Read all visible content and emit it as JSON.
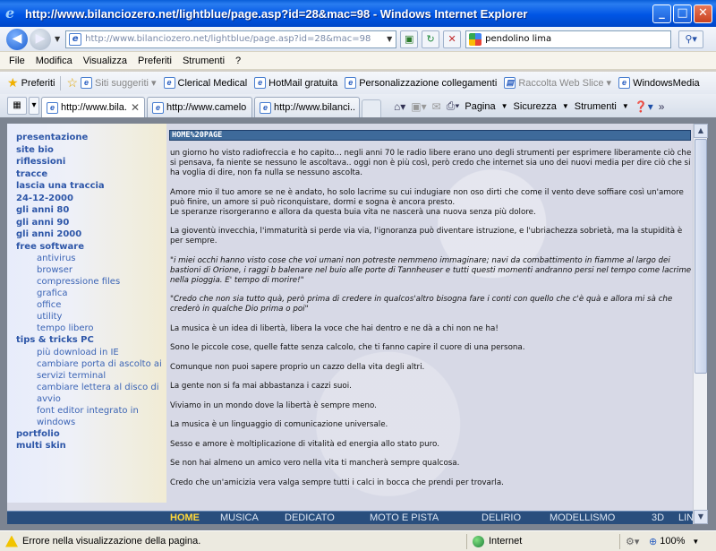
{
  "window": {
    "title": "http://www.bilanciozero.net/lightblue/page.asp?id=28&mac=98 - Windows Internet Explorer",
    "buttons": {
      "minimize": "_",
      "maximize": "□",
      "close": "✕"
    }
  },
  "address": {
    "url": "http://www.bilanciozero.net/lightblue/page.asp?id=28&mac=98",
    "search_query": "pendolino lima"
  },
  "menu": [
    "File",
    "Modifica",
    "Visualizza",
    "Preferiti",
    "Strumenti",
    "?"
  ],
  "favorites": {
    "label": "Preferiti",
    "items": [
      "Siti suggeriti",
      "Clerical Medical",
      "HotMail gratuita",
      "Personalizzazione collegamenti",
      "Raccolta Web Slice",
      "WindowsMedia"
    ]
  },
  "tabs": [
    {
      "label": "http://www.bila..."
    },
    {
      "label": "http://www.camelo..."
    },
    {
      "label": "http://www.bilanci..."
    }
  ],
  "commands": {
    "page": "Pagina",
    "security": "Sicurezza",
    "tools": "Strumenti"
  },
  "sidebar": {
    "items": [
      {
        "label": "presentazione",
        "sub": false
      },
      {
        "label": "site bio",
        "sub": false
      },
      {
        "label": "riflessioni",
        "sub": false
      },
      {
        "label": "tracce",
        "sub": false
      },
      {
        "label": "lascia una traccia",
        "sub": false
      },
      {
        "label": "24-12-2000",
        "sub": false
      },
      {
        "label": "gli anni 80",
        "sub": false
      },
      {
        "label": "gli anni 90",
        "sub": false
      },
      {
        "label": "gli anni 2000",
        "sub": false
      },
      {
        "label": "free software",
        "sub": false
      },
      {
        "label": "antivirus",
        "sub": true
      },
      {
        "label": "browser",
        "sub": true
      },
      {
        "label": "compressione files",
        "sub": true
      },
      {
        "label": "grafica",
        "sub": true
      },
      {
        "label": "office",
        "sub": true
      },
      {
        "label": "utility",
        "sub": true
      },
      {
        "label": "tempo libero",
        "sub": true
      },
      {
        "label": "tips & tricks PC",
        "sub": false
      },
      {
        "label": "più download in IE",
        "sub": true
      },
      {
        "label": "cambiare porta di ascolto ai servizi terminal",
        "sub": true
      },
      {
        "label": "cambiare lettera al disco di avvio",
        "sub": true
      },
      {
        "label": "font editor integrato in windows",
        "sub": true
      },
      {
        "label": "portfolio",
        "sub": false
      },
      {
        "label": "multi skin",
        "sub": false
      }
    ]
  },
  "content": {
    "heading": "HOME%20PAGE",
    "paragraphs": [
      {
        "text": "un giorno ho visto radiofreccia e ho capito... negli anni 70 le radio libere erano uno degli strumenti per esprimere liberamente ciò che si pensava, fa niente se nessuno le ascoltava.. oggi non è più così, però credo che internet sia uno dei nuovi media per dire ciò che si ha voglia di dire, non fa nulla se nessuno ascolta.",
        "italic": false
      },
      {
        "text": "Amore mio il tuo amore se ne è andato, ho solo lacrime su cui indugiare non oso dirti che come il vento deve soffiare così un'amore può finire, un amore si può riconquistare, dormi e sogna è ancora presto.\nLe speranze risorgeranno e allora da questa buia vita ne nascerà una nuova senza più dolore.",
        "italic": false
      },
      {
        "text": "La gioventù invecchia, l'immaturità si perde via via, l'ignoranza può diventare istruzione, e l'ubriachezza sobrietà, ma la stupidità è per sempre.",
        "italic": false
      },
      {
        "text": "\"i miei occhi hanno visto cose che voi umani non potreste nemmeno immaginare; navi da combattimento in fiamme al largo dei bastioni di Orione, i raggi b balenare nel buio alle porte di Tannheuser e tutti questi momenti andranno persi nel tempo come lacrime nella pioggia. E' tempo di morire!\"",
        "italic": true
      },
      {
        "text": "\"Credo che non sia tutto quà, però prima di credere in qualcos'altro bisogna fare i conti con quello che c'è quà e allora mi sà che crederò in qualche Dio prima o poi\"",
        "italic": true
      },
      {
        "text": "La musica è un idea di libertà, libera la voce che hai dentro e ne dà a chi non ne ha!",
        "italic": false
      },
      {
        "text": "Sono le piccole cose, quelle fatte senza calcolo, che ti fanno capire il cuore di una persona.",
        "italic": false
      },
      {
        "text": "Comunque non puoi sapere proprio un cazzo della vita degli altri.",
        "italic": false
      },
      {
        "text": "La gente non si fa mai abbastanza i cazzi suoi.",
        "italic": false
      },
      {
        "text": "Viviamo in un mondo dove la libertà è sempre meno.",
        "italic": false
      },
      {
        "text": "La musica è un linguaggio di comunicazione universale.",
        "italic": false
      },
      {
        "text": "Sesso e amore è moltiplicazione di vitalità ed energia allo stato puro.",
        "italic": false
      },
      {
        "text": "Se non hai almeno un amico vero nella vita ti mancherà sempre qualcosa.",
        "italic": false
      },
      {
        "text": "Credo che un'amicizia vera valga sempre tutti i calci in bocca che prendi per trovarla.",
        "italic": false
      }
    ]
  },
  "bottom_menu": [
    {
      "label": "HOME",
      "active": true
    },
    {
      "label": "MUSICA",
      "active": false
    },
    {
      "label": "DEDICATO",
      "active": false
    },
    {
      "label": "MOTO E PISTA",
      "active": false
    },
    {
      "label": "DELIRIO",
      "active": false
    },
    {
      "label": "MODELLISMO",
      "active": false
    },
    {
      "label": "3D",
      "active": false
    },
    {
      "label": "LINK",
      "active": false
    }
  ],
  "status": {
    "message": "Errore nella visualizzazione della pagina.",
    "zone": "Internet",
    "zoom": "100%"
  },
  "colors": {
    "titlebar": "#0055e5",
    "nav_link": "#2d56a8",
    "heading_bar": "#3e6a9a",
    "bottom_menu": "#294e7d",
    "bottom_active": "#ffd83a"
  }
}
